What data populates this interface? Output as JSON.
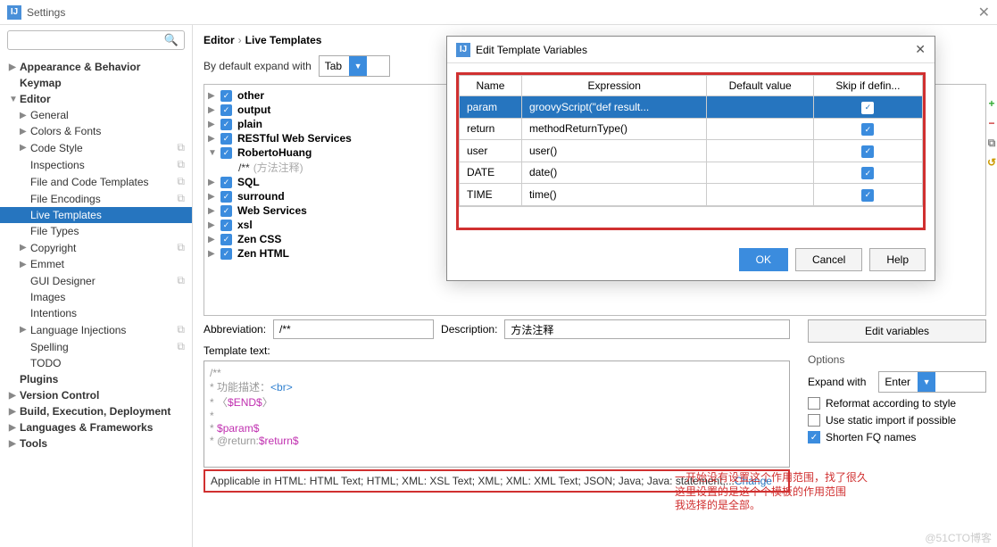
{
  "window": {
    "title": "Settings"
  },
  "sidebar": {
    "search_placeholder": "",
    "items": [
      {
        "label": "Appearance & Behavior",
        "bold": true,
        "lvl": 0,
        "arrow": "▶"
      },
      {
        "label": "Keymap",
        "bold": true,
        "lvl": 0,
        "arrow": ""
      },
      {
        "label": "Editor",
        "bold": true,
        "lvl": 0,
        "arrow": "▼"
      },
      {
        "label": "General",
        "lvl": 1,
        "arrow": "▶"
      },
      {
        "label": "Colors & Fonts",
        "lvl": 1,
        "arrow": "▶"
      },
      {
        "label": "Code Style",
        "lvl": 1,
        "arrow": "▶",
        "stack": true
      },
      {
        "label": "Inspections",
        "lvl": 1,
        "arrow": "",
        "stack": true
      },
      {
        "label": "File and Code Templates",
        "lvl": 1,
        "arrow": "",
        "stack": true
      },
      {
        "label": "File Encodings",
        "lvl": 1,
        "arrow": "",
        "stack": true
      },
      {
        "label": "Live Templates",
        "lvl": 1,
        "arrow": "",
        "selected": true
      },
      {
        "label": "File Types",
        "lvl": 1,
        "arrow": ""
      },
      {
        "label": "Copyright",
        "lvl": 1,
        "arrow": "▶",
        "stack": true
      },
      {
        "label": "Emmet",
        "lvl": 1,
        "arrow": "▶"
      },
      {
        "label": "GUI Designer",
        "lvl": 1,
        "arrow": "",
        "stack": true
      },
      {
        "label": "Images",
        "lvl": 1,
        "arrow": ""
      },
      {
        "label": "Intentions",
        "lvl": 1,
        "arrow": ""
      },
      {
        "label": "Language Injections",
        "lvl": 1,
        "arrow": "▶",
        "stack": true
      },
      {
        "label": "Spelling",
        "lvl": 1,
        "arrow": "",
        "stack": true
      },
      {
        "label": "TODO",
        "lvl": 1,
        "arrow": ""
      },
      {
        "label": "Plugins",
        "bold": true,
        "lvl": 0,
        "arrow": ""
      },
      {
        "label": "Version Control",
        "bold": true,
        "lvl": 0,
        "arrow": "▶"
      },
      {
        "label": "Build, Execution, Deployment",
        "bold": true,
        "lvl": 0,
        "arrow": "▶"
      },
      {
        "label": "Languages & Frameworks",
        "bold": true,
        "lvl": 0,
        "arrow": "▶"
      },
      {
        "label": "Tools",
        "bold": true,
        "lvl": 0,
        "arrow": "▶"
      }
    ]
  },
  "breadcrumb": {
    "a": "Editor",
    "b": "Live Templates"
  },
  "expand": {
    "label": "By default expand with",
    "value": "Tab"
  },
  "templates": [
    {
      "label": "other",
      "arrow": "▶"
    },
    {
      "label": "output",
      "arrow": "▶"
    },
    {
      "label": "plain",
      "arrow": "▶"
    },
    {
      "label": "RESTful Web Services",
      "arrow": "▶"
    },
    {
      "label": "RobertoHuang",
      "arrow": "▼",
      "sub": {
        "name": "/**",
        "desc": "(方法注释)"
      }
    },
    {
      "label": "SQL",
      "arrow": "▶"
    },
    {
      "label": "surround",
      "arrow": "▶"
    },
    {
      "label": "Web Services",
      "arrow": "▶"
    },
    {
      "label": "xsl",
      "arrow": "▶"
    },
    {
      "label": "Zen CSS",
      "arrow": "▶"
    },
    {
      "label": "Zen HTML",
      "arrow": "▶"
    }
  ],
  "form": {
    "abbr_label": "Abbreviation:",
    "abbr_value": "/**",
    "desc_label": "Description:",
    "desc_value": "方法注释",
    "tt_label": "Template text:",
    "tt_lines": [
      "/**",
      " * 功能描述：<br>",
      " * 〈$END$〉",
      " *",
      " * $param$",
      " * @return:$return$"
    ],
    "annotation_l1": "一开始没有设置这个作用范围，找了很久",
    "annotation_l2": "这里设置的是这个个模板的作用范围",
    "annotation_l3": "我选择的是全部。",
    "applicable": "Applicable in HTML: HTML Text; HTML; XML: XSL Text; XML; XML: XML Text; JSON; Java; Java: statement,...",
    "change": "Change"
  },
  "right": {
    "edit_vars": "Edit variables",
    "options": "Options",
    "expand_with": "Expand with",
    "expand_val": "Enter",
    "opt1": "Reformat according to style",
    "opt2": "Use static import if possible",
    "opt3": "Shorten FQ names"
  },
  "dialog": {
    "title": "Edit Template Variables",
    "cols": [
      "Name",
      "Expression",
      "Default value",
      "Skip if defin..."
    ],
    "rows": [
      {
        "name": "param",
        "expr": "groovyScript(\"def result...",
        "sel": true
      },
      {
        "name": "return",
        "expr": "methodReturnType()"
      },
      {
        "name": "user",
        "expr": "user()"
      },
      {
        "name": "DATE",
        "expr": "date()"
      },
      {
        "name": "TIME",
        "expr": "time()"
      }
    ],
    "ok": "OK",
    "cancel": "Cancel",
    "help": "Help"
  },
  "watermark": "@51CTO博客"
}
